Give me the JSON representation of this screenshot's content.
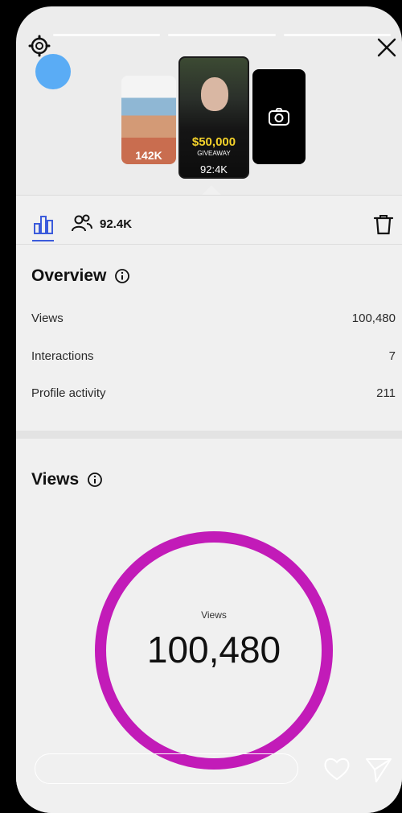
{
  "story": {
    "progress_segments": 3
  },
  "thumbnails": {
    "left_count": "142K",
    "center_amount": "$50,000",
    "center_label": "GIVEAWAY",
    "center_count": "92:4K"
  },
  "tabs": {
    "audience_count": "92.4K"
  },
  "overview": {
    "title": "Overview",
    "metrics": [
      {
        "label": "Views",
        "value": "100,480"
      },
      {
        "label": "Interactions",
        "value": "7"
      },
      {
        "label": "Profile activity",
        "value": "211"
      }
    ]
  },
  "views": {
    "title": "Views",
    "ring_label": "Views",
    "ring_value": "100,480",
    "ring_color": "#c21bb8"
  },
  "reply": {
    "placeholder": ""
  },
  "colors": {
    "accent": "#3b5bdb",
    "avatar": "#5aacf5",
    "giveaway": "#f4d22a"
  },
  "icons": [
    "gear-icon",
    "close-icon",
    "insights-icon",
    "people-icon",
    "trash-icon",
    "info-icon",
    "camera-icon",
    "heart-icon",
    "send-icon"
  ]
}
